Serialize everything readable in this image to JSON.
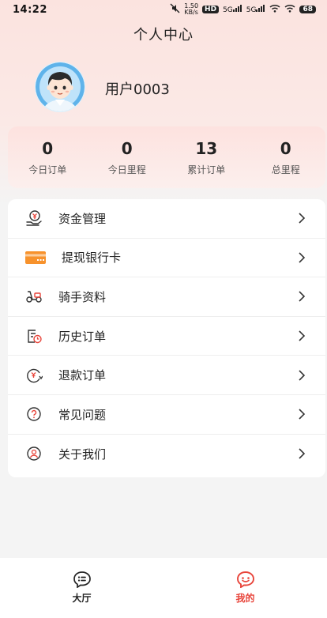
{
  "status_bar": {
    "time": "14:22",
    "speed_value": "1.50",
    "speed_unit": "KB/s",
    "hd_badge": "HD",
    "signal_1": "5G",
    "signal_2": "5G",
    "battery": "68"
  },
  "header": {
    "title": "个人中心"
  },
  "user": {
    "name": "用户0003",
    "avatar_icon": "user-avatar-boy"
  },
  "stats": [
    {
      "value": "0",
      "label": "今日订单"
    },
    {
      "value": "0",
      "label": "今日里程"
    },
    {
      "value": "13",
      "label": "累计订单"
    },
    {
      "value": "0",
      "label": "总里程"
    }
  ],
  "menu": {
    "items": [
      {
        "label": "资金管理",
        "icon": "money-hand-icon"
      },
      {
        "label": "提现银行卡",
        "icon": "bank-card-icon"
      },
      {
        "label": "骑手资料",
        "icon": "scooter-icon"
      },
      {
        "label": "历史订单",
        "icon": "order-history-icon"
      },
      {
        "label": "退款订单",
        "icon": "refund-icon"
      },
      {
        "label": "常见问题",
        "icon": "question-icon"
      },
      {
        "label": "关于我们",
        "icon": "about-us-icon"
      }
    ]
  },
  "tabs": [
    {
      "label": "大厅",
      "icon": "hall-icon",
      "active": false
    },
    {
      "label": "我的",
      "icon": "mine-icon",
      "active": true
    }
  ],
  "colors": {
    "accent": "#e8443a",
    "card_orange": "#f7922c",
    "text": "#222222"
  }
}
